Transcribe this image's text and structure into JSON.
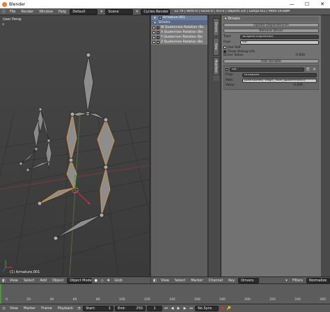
{
  "window": {
    "title": "Blender",
    "min": "—",
    "max": "☐",
    "close": "✕"
  },
  "info_header": {
    "menus": [
      "File",
      "Render",
      "Window",
      "Help"
    ],
    "layout": "Default",
    "scene": "Scene",
    "engine": "Cycles Render",
    "stats": "v2.79 | Verts:0 | Faces:0 | Tris:0 | Objects:1/4 | Lamps:0/1 | Mem:19.68M"
  },
  "viewport": {
    "label": "User Persp",
    "object_label": "(1) Armature.001"
  },
  "channels": {
    "object": "Armature.001",
    "group": "Drivers",
    "items": [
      {
        "label": "W Quaternion Rotation (Bo",
        "color": "#d64a4a"
      },
      {
        "label": "X Quaternion Rotation (Bo",
        "color": "#5ab85a"
      },
      {
        "label": "Y Quaternion Rotation (Bo",
        "color": "#4a7ad6"
      },
      {
        "label": "Z Quaternion Rotation (Bo",
        "color": "#c8c850"
      }
    ]
  },
  "tabs": [
    "Drivers",
    "View",
    "Modifiers"
  ],
  "drivers_panel": {
    "title": "Drivers",
    "update_dependencies": "Update Dependencies",
    "remove_driver": "Remove Driver",
    "type_label": "Type",
    "type_value": "Scripted Expression",
    "expr_label": "Expr",
    "expr_value": "var",
    "use_self": "Use Self",
    "show_debug": "Show Debug Info",
    "driver_value_label": "Driver Value:",
    "driver_value": "-0.000",
    "add_variable": "Add Variable",
    "var_name": "var",
    "prop_label": "Prop:",
    "prop_value": "Armature",
    "path_label": "Path:",
    "path_value": "pose.bones[\"thigh_ fkon_quaternion[0]",
    "value_label": "Value:",
    "value_value": "-0.000"
  },
  "view_header": {
    "view": "View",
    "select": "Select",
    "add": "Add",
    "object": "Object",
    "mode": "Object Mode",
    "global": "Glob"
  },
  "driver_header": {
    "view": "View",
    "select": "Select",
    "marker": "Marker",
    "channel": "Channel",
    "key": "Key",
    "mode": "Drivers",
    "filters": "Filters",
    "normalize": "Normalize"
  },
  "timeline_footer": {
    "view": "View",
    "marker": "Marker",
    "frame": "Frame",
    "playback": "Playback",
    "start_label": "Start:",
    "start": "1",
    "end_label": "End:",
    "end": "250",
    "current": "1",
    "sync": "No Sync"
  },
  "timeline_ticks": [
    "0",
    "20",
    "40",
    "60",
    "80",
    "100",
    "120",
    "140",
    "160",
    "180",
    "200",
    "220",
    "240",
    "260"
  ]
}
